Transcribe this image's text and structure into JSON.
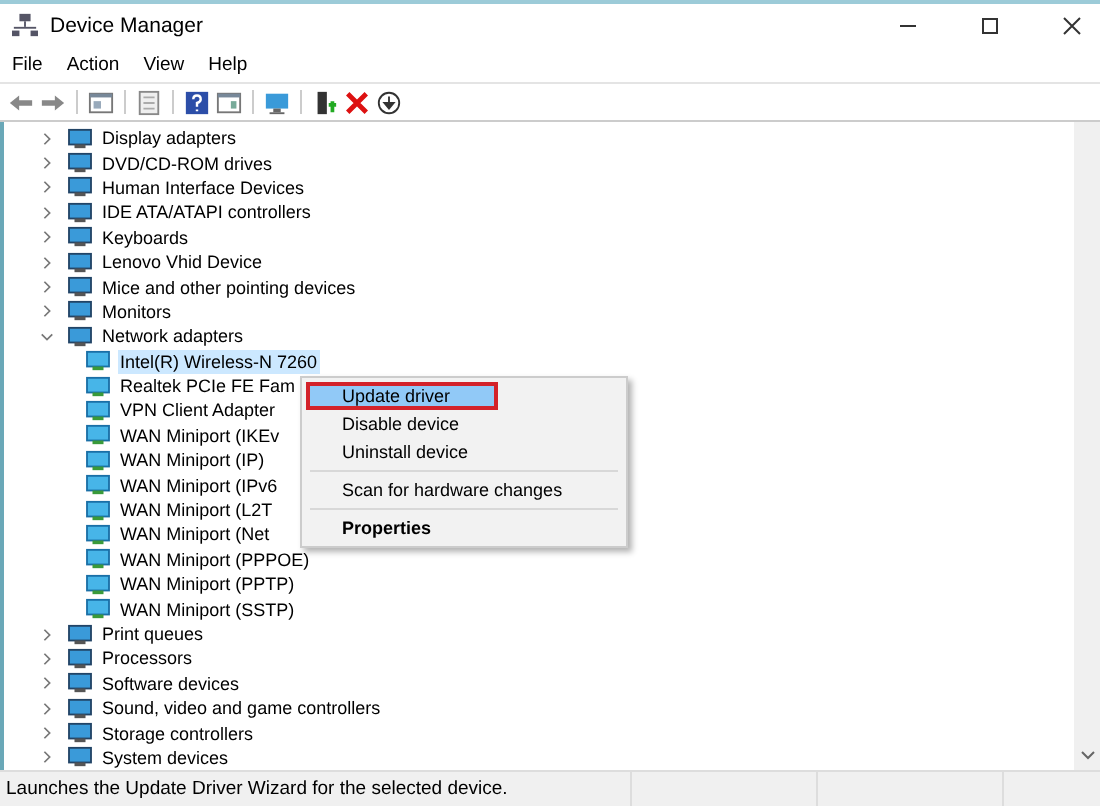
{
  "window": {
    "title": "Device Manager"
  },
  "menu_bar": [
    "File",
    "Action",
    "View",
    "Help"
  ],
  "tree": [
    {
      "label": "Display adapters",
      "expanded": false
    },
    {
      "label": "DVD/CD-ROM drives",
      "expanded": false
    },
    {
      "label": "Human Interface Devices",
      "expanded": false
    },
    {
      "label": "IDE ATA/ATAPI controllers",
      "expanded": false
    },
    {
      "label": "Keyboards",
      "expanded": false
    },
    {
      "label": "Lenovo Vhid Device",
      "expanded": false
    },
    {
      "label": "Mice and other pointing devices",
      "expanded": false
    },
    {
      "label": "Monitors",
      "expanded": false
    },
    {
      "label": "Network adapters",
      "expanded": true,
      "children": [
        {
          "label": "Intel(R) Wireless-N 7260",
          "selected": true
        },
        {
          "label": "Realtek PCIe FE Fam",
          "selected": false
        },
        {
          "label": "VPN Client Adapter",
          "selected": false
        },
        {
          "label": "WAN Miniport (IKEv",
          "selected": false
        },
        {
          "label": "WAN Miniport (IP)",
          "selected": false
        },
        {
          "label": "WAN Miniport (IPv6",
          "selected": false
        },
        {
          "label": "WAN Miniport (L2T",
          "selected": false
        },
        {
          "label": "WAN Miniport (Net",
          "selected": false
        },
        {
          "label": "WAN Miniport (PPPOE)",
          "selected": false
        },
        {
          "label": "WAN Miniport (PPTP)",
          "selected": false
        },
        {
          "label": "WAN Miniport (SSTP)",
          "selected": false
        }
      ]
    },
    {
      "label": "Print queues",
      "expanded": false
    },
    {
      "label": "Processors",
      "expanded": false
    },
    {
      "label": "Software devices",
      "expanded": false
    },
    {
      "label": "Sound, video and game controllers",
      "expanded": false
    },
    {
      "label": "Storage controllers",
      "expanded": false
    },
    {
      "label": "System devices",
      "expanded": false
    }
  ],
  "context_menu": [
    {
      "kind": "item",
      "label": "Update driver",
      "selected": true
    },
    {
      "kind": "item",
      "label": "Disable device",
      "selected": false
    },
    {
      "kind": "item",
      "label": "Uninstall device",
      "selected": false
    },
    {
      "kind": "separator"
    },
    {
      "kind": "item",
      "label": "Scan for hardware changes",
      "selected": false
    },
    {
      "kind": "separator"
    },
    {
      "kind": "default",
      "label": "Properties",
      "selected": false
    }
  ],
  "status_bar": "Launches the Update Driver Wizard for the selected device."
}
